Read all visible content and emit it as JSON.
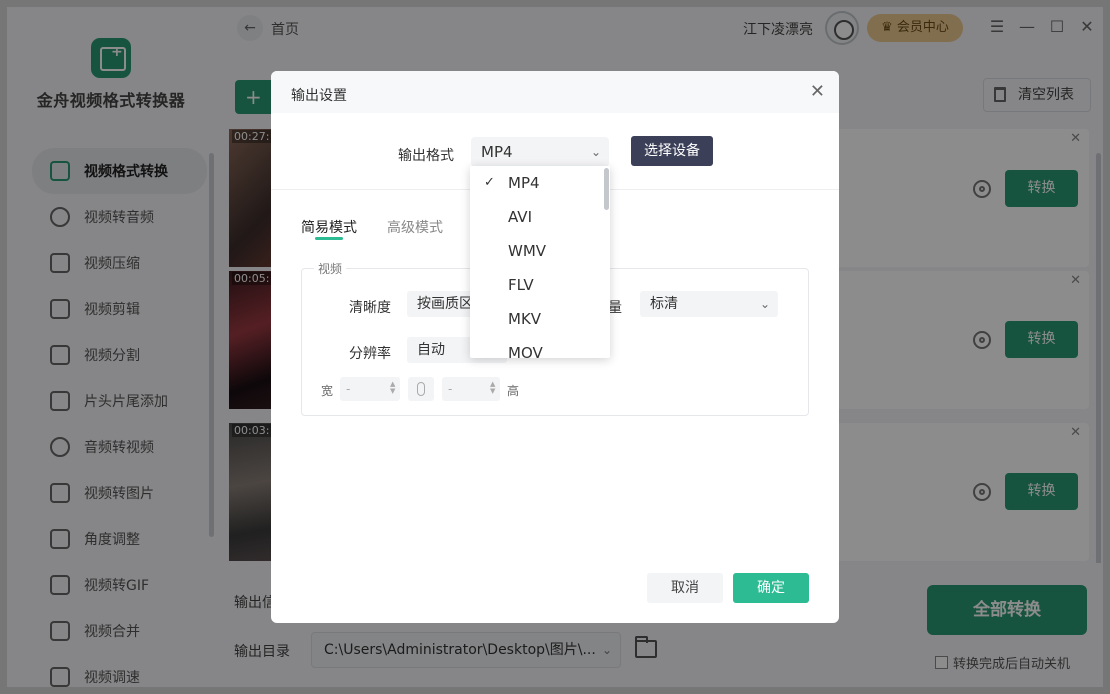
{
  "app": {
    "name": "金舟视频格式转换器"
  },
  "sidebar": {
    "items": [
      {
        "label": "视频格式转换",
        "icon": "format-convert-icon",
        "active": true
      },
      {
        "label": "视频转音频",
        "icon": "music-note-icon"
      },
      {
        "label": "视频压缩",
        "icon": "compress-icon"
      },
      {
        "label": "视频剪辑",
        "icon": "scissors-icon"
      },
      {
        "label": "视频分割",
        "icon": "split-icon"
      },
      {
        "label": "片头片尾添加",
        "icon": "film-strip-icon"
      },
      {
        "label": "音频转视频",
        "icon": "disc-icon"
      },
      {
        "label": "视频转图片",
        "icon": "image-icon"
      },
      {
        "label": "角度调整",
        "icon": "rotate-icon"
      },
      {
        "label": "视频转GIF",
        "icon": "gif-file-icon"
      },
      {
        "label": "视频合并",
        "icon": "merge-icon"
      },
      {
        "label": "视频调速",
        "icon": "speed-icon"
      }
    ]
  },
  "topbar": {
    "breadcrumb": "首页",
    "username": "江下凌漂亮",
    "vip_label": "会员中心"
  },
  "toolbar": {
    "add_label": "+",
    "clear_label": "清空列表"
  },
  "files": [
    {
      "time": "00:27:",
      "convert_label": "转换"
    },
    {
      "time": "00:05:",
      "convert_label": "转换"
    },
    {
      "time": "00:03:",
      "convert_label": "转换"
    }
  ],
  "bottom": {
    "output_format_label": "输出信",
    "output_dir_label": "输出目录",
    "output_dir_value": "C:\\Users\\Administrator\\Desktop\\图片\\...",
    "convert_all_label": "全部转换",
    "auto_shutdown_label": "转换完成后自动关机"
  },
  "dialog": {
    "title": "输出设置",
    "format_label": "输出格式",
    "format_value": "MP4",
    "select_device_label": "选择设备",
    "tabs": [
      {
        "label": "简易模式",
        "active": true
      },
      {
        "label": "高级模式",
        "active": false
      }
    ],
    "video_group": {
      "title": "视频",
      "clarity_label": "清晰度",
      "clarity_value": "按画质区",
      "quality_label": "量",
      "quality_value": "标清",
      "resolution_label": "分辨率",
      "resolution_value": "自动",
      "width_label": "宽",
      "width_value": "-",
      "height_value": "-",
      "height_label": "高"
    },
    "cancel_label": "取消",
    "ok_label": "确定"
  },
  "format_dropdown": {
    "options": [
      "MP4",
      "AVI",
      "WMV",
      "FLV",
      "MKV",
      "MOV"
    ],
    "selected": "MP4"
  },
  "colors": {
    "accent": "#2a9a73",
    "dialog_accent": "#2dbb93",
    "device_button": "#3b3f58",
    "vip": "#e9c88e"
  }
}
